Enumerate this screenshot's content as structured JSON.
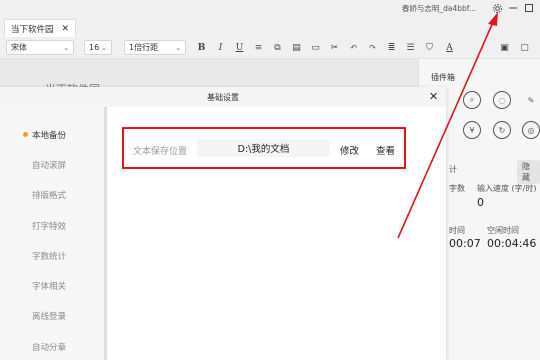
{
  "window": {
    "user_label": "春娇与志明_da4bbf...",
    "icons": [
      "gear-icon",
      "minimize-icon",
      "maximize-icon"
    ]
  },
  "tab": {
    "label": "当下软件园",
    "close": "✕"
  },
  "toolbar": {
    "font_family": "宋体",
    "font_size": "16",
    "line_spacing": "1倍行距"
  },
  "editor": {
    "title": "当下软件园"
  },
  "right_panel": {
    "plugin_title": "插件箱",
    "stats_suffix": "计",
    "hide_label": "隐藏",
    "word_count_label": "字数",
    "input_speed_label": "输入速度 (字/时)",
    "input_speed_value": "0",
    "time_label": "时间",
    "idle_time_label": "空闲时间",
    "time_value": "00:07",
    "idle_time_value": "00:04:46"
  },
  "dialog": {
    "title": "基础设置",
    "close": "✕",
    "nav": [
      "本地备份",
      "自动滚屏",
      "排版格式",
      "打字特效",
      "字数统计",
      "字体相关",
      "离线登录",
      "自动分章"
    ],
    "active_index": 0,
    "save_location": {
      "label": "文本保存位置",
      "path": "D:\\我的文档",
      "modify_label": "修改",
      "view_label": "查看"
    }
  },
  "colors": {
    "highlight_red": "#e0161d",
    "active_dot": "#f0a020"
  }
}
